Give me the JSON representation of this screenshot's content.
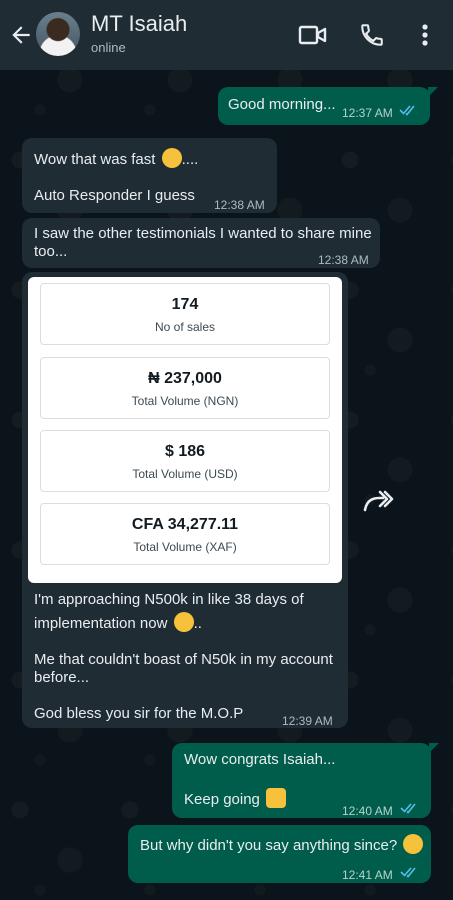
{
  "contact": {
    "name": "MT Isaiah",
    "status": "online"
  },
  "messages": {
    "m1": {
      "text": "Good morning...",
      "time": "12:37 AM"
    },
    "m2": {
      "line1": "Wow that was fast",
      "line1_suffix": "....",
      "line2": "Auto Responder I guess",
      "time": "12:38 AM"
    },
    "m3": {
      "line1": "I saw the other testimonials I wanted to share mine",
      "line2": "too...",
      "time": "12:38 AM"
    },
    "m4": {
      "line1": "I'm approaching N500k in like 38 days of",
      "line2": "implementation now",
      "line2_suffix": "..",
      "line3": "Me that couldn't boast of N50k in my account",
      "line4": "before...",
      "line5": "God bless you sir for the M.O.P",
      "time": "12:39 AM"
    },
    "m5": {
      "line1": "Wow congrats Isaiah...",
      "line2": "Keep going",
      "time": "12:40 AM"
    },
    "m6": {
      "text": "But why didn't you say anything since?",
      "time": "12:41 AM"
    }
  },
  "stats": [
    {
      "value": "174",
      "label": "No of sales"
    },
    {
      "value": "₦ 237,000",
      "label": "Total Volume (NGN)"
    },
    {
      "value": "$ 186",
      "label": "Total Volume (USD)"
    },
    {
      "value": "CFA 34,277.11",
      "label": "Total Volume (XAF)"
    }
  ],
  "icons": {
    "back": "arrow-left-icon",
    "video": "video-call-icon",
    "call": "phone-icon",
    "menu": "more-vertical-icon",
    "forward": "forward-icon",
    "read": "double-check-icon"
  },
  "colors": {
    "header": "#1f2c34",
    "incoming": "#1f2c34",
    "outgoing": "#005c4b",
    "read_ticks": "#53bdeb"
  }
}
